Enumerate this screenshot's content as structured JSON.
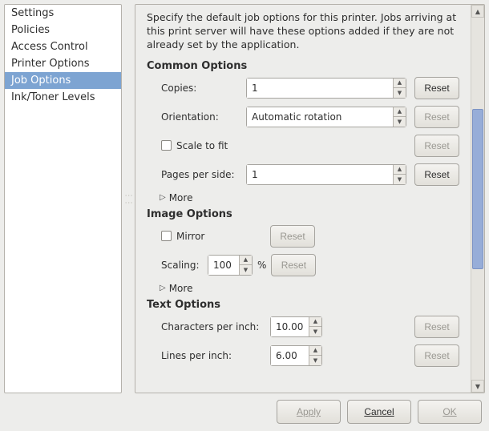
{
  "sidebar": {
    "items": [
      {
        "label": "Settings"
      },
      {
        "label": "Policies"
      },
      {
        "label": "Access Control"
      },
      {
        "label": "Printer Options"
      },
      {
        "label": "Job Options"
      },
      {
        "label": "Ink/Toner Levels"
      }
    ]
  },
  "main": {
    "description": "Specify the default job options for this printer.  Jobs arriving at this print server will have these options added if they are not already set by the application.",
    "reset_label": "Reset",
    "more_label": "More",
    "common": {
      "heading": "Common Options",
      "copies_label": "Copies:",
      "copies_value": "1",
      "orientation_label": "Orientation:",
      "orientation_value": "Automatic rotation",
      "scale_to_fit_label": "Scale to fit",
      "pages_per_side_label": "Pages per side:",
      "pages_per_side_value": "1"
    },
    "image": {
      "heading": "Image Options",
      "mirror_label": "Mirror",
      "scaling_label": "Scaling:",
      "scaling_value": "100",
      "scaling_unit": "%"
    },
    "text": {
      "heading": "Text Options",
      "cpi_label": "Characters per inch:",
      "cpi_value": "10.00",
      "lpi_label": "Lines per inch:",
      "lpi_value": "6.00"
    }
  },
  "footer": {
    "apply": "Apply",
    "cancel": "Cancel",
    "ok": "OK"
  }
}
